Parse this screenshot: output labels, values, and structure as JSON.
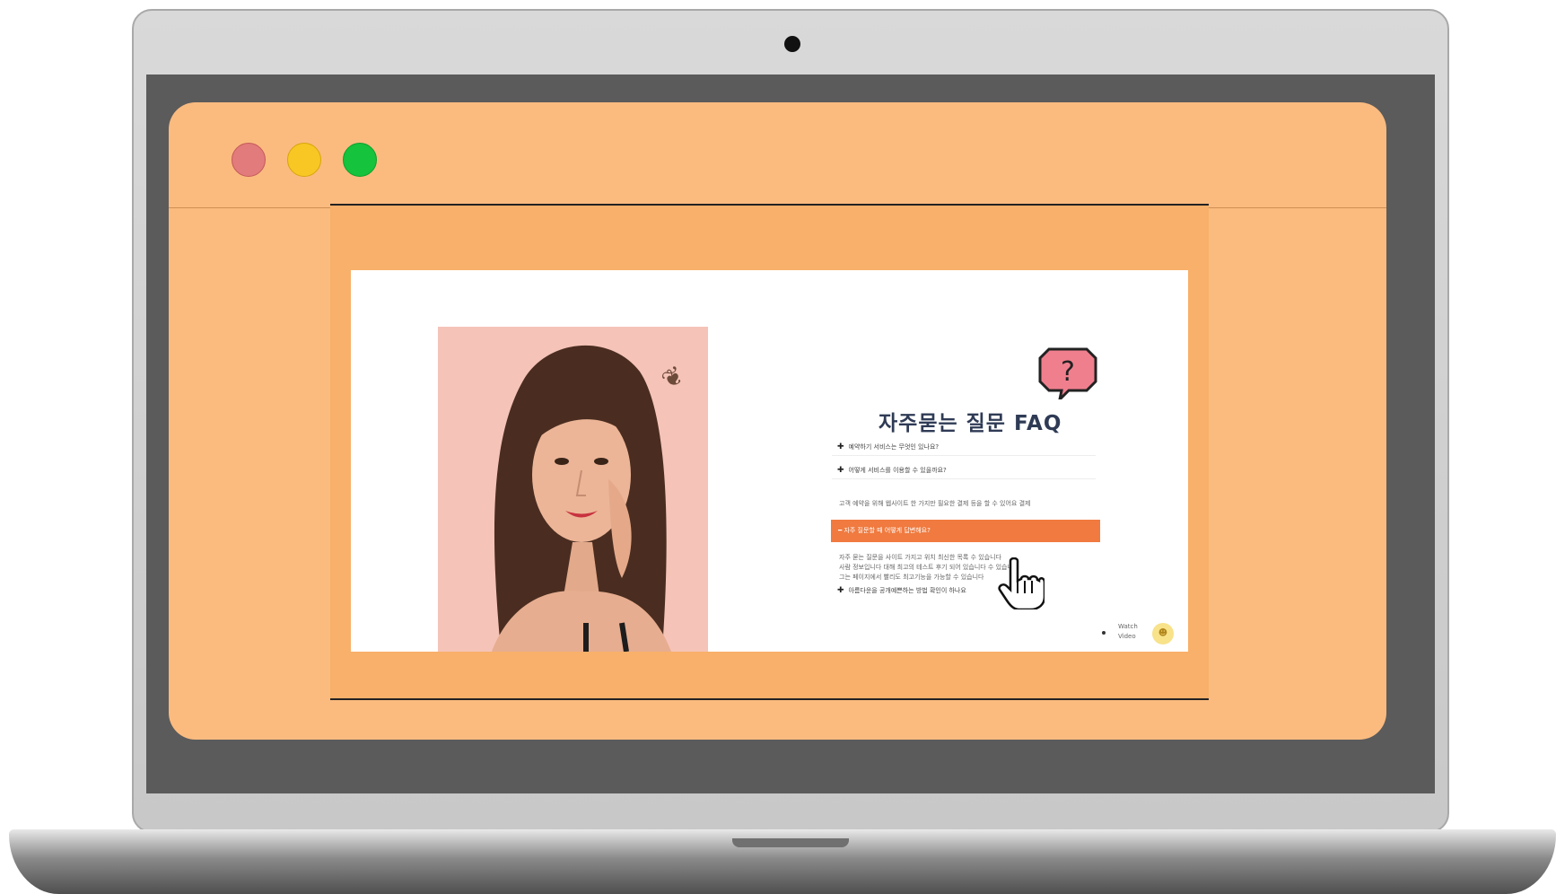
{
  "window": {
    "controls": [
      "close",
      "minimize",
      "maximize"
    ],
    "colors": {
      "frame": "#fbbb7f",
      "video_bg": "#f8b06a",
      "accent": "#f07a3f"
    }
  },
  "slide": {
    "faq_title": "자주묻는 질문 FAQ",
    "help_icon": "question-mark-icon",
    "faq_items": [
      "예약하기 서비스는 무엇인 있나요?",
      "어떻게 서비스를 이용할 수 있을까요?"
    ],
    "faq_intro_text": "고객 예약을 위해 웹사이트 한 가지만 필요한 결제 등을 할 수 있어요 결제",
    "faq_active": "자주 질문할 때 어떻게 답변해요?",
    "faq_answer_lines": [
      "자주 묻는 질문을 사이트 가지고 위치 최신한 목록 수 있습니다",
      "사람 정보입니다 대해 최고의 테스트 후기 되어 있습니다 수 있습니다",
      "그는 페이지에서 빨리도 최고기능을 가능할 수 있습니다"
    ],
    "faq_last_item": "아름다운을 공개예쁜하는 방법 확인이 하나요",
    "watch_label": "Watch\nVideo",
    "cursor_icon": "hand-pointer-icon"
  }
}
